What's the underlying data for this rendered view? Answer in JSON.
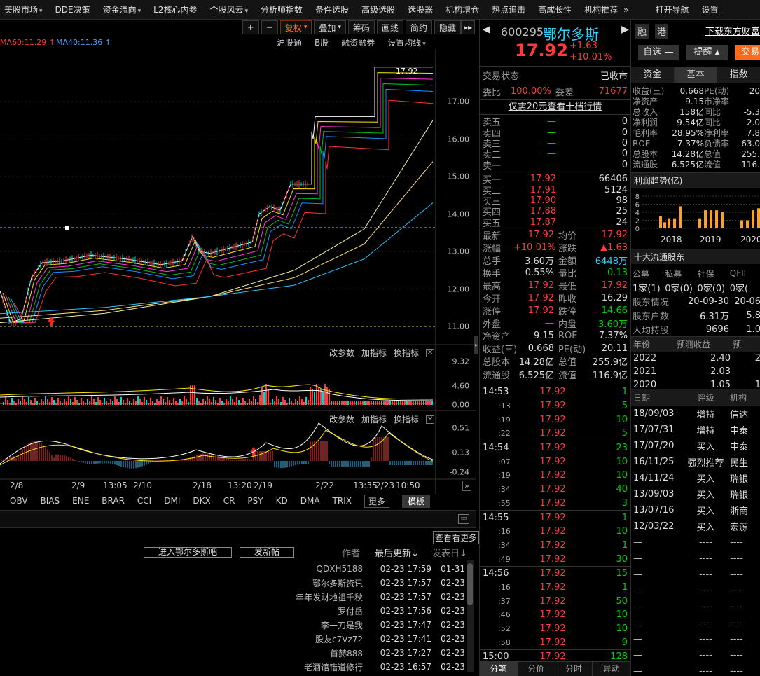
{
  "menu": [
    {
      "t": "美股市场",
      "c": true
    },
    {
      "t": "DDE决策",
      "c": false
    },
    {
      "t": "资金流向",
      "c": true
    },
    {
      "t": "L2核心内参",
      "c": false
    },
    {
      "t": "个股风云",
      "c": true
    },
    {
      "t": "分析师指数",
      "c": false
    },
    {
      "t": "条件选股",
      "c": false
    },
    {
      "t": "高级选股",
      "c": false
    },
    {
      "t": "选股器",
      "c": false
    },
    {
      "t": "机构增仓",
      "c": false
    },
    {
      "t": "热点追击",
      "c": false
    },
    {
      "t": "高成长性",
      "c": false
    },
    {
      "t": "机构推荐",
      "c": false
    },
    {
      "t": "»",
      "c": false
    },
    {
      "t": "打开导航",
      "c": false
    },
    {
      "t": "设置",
      "c": false
    }
  ],
  "toolbar": {
    "plus": "+",
    "minus": "−",
    "fq": "复权",
    "overlay": "叠加",
    "chip": "筹码",
    "draw": "画线",
    "simple": "简约",
    "hide": "隐藏",
    "expand": "▸▸"
  },
  "ma": {
    "ma60_label": "MA60:11.29",
    "ma40_label": "MA40:11.36",
    "links": [
      "沪股通",
      "B股",
      "融资融券",
      "设置均线"
    ]
  },
  "price_axis": [
    "17.00",
    "16.00",
    "15.00",
    "14.00",
    "13.00",
    "12.00",
    "11.00"
  ],
  "price_tag": "17.92",
  "sub1": {
    "buttons": [
      "改参数",
      "加指标",
      "换指标"
    ],
    "axis": [
      "9.32",
      "4.60",
      "0.00"
    ]
  },
  "sub2": {
    "buttons": [
      "改参数",
      "加指标",
      "换指标"
    ],
    "axis": [
      "0.51",
      "0.13",
      "-0.24"
    ]
  },
  "dates": [
    "2/8",
    "2/9",
    "13:05",
    "2/10",
    "2/18",
    "13:20",
    "2/19",
    "2/22",
    "13:35",
    "2/23",
    "10:50"
  ],
  "indicators": [
    "OBV",
    "BIAS",
    "ENE",
    "BRAR",
    "CCI",
    "DMI",
    "DKX",
    "CR",
    "PSY",
    "KD",
    "DMA",
    "TRIX"
  ],
  "ind_more": "更多",
  "ind_tpl": "模板",
  "forum": {
    "more": "查看看更多",
    "enter": "进入鄂尔多斯吧",
    "post": "发新帖",
    "author": "作者",
    "latest": "最后更新↓",
    "published": "发表日↓",
    "rows": [
      {
        "u": "QDXH5188",
        "t": "02-23 17:59",
        "d": "01-31"
      },
      {
        "u": "鄂尔多斯资讯",
        "t": "02-23 17:57",
        "d": "02-23"
      },
      {
        "u": "年年发财地祖千秋",
        "t": "02-23 17:57",
        "d": "02-23"
      },
      {
        "u": "罗付岳",
        "t": "02-23 17:56",
        "d": "02-23"
      },
      {
        "u": "李一刀是我",
        "t": "02-23 17:47",
        "d": "02-23"
      },
      {
        "u": "股友c7Vz72",
        "t": "02-23 17:41",
        "d": "02-23"
      },
      {
        "u": "首赫888",
        "t": "02-23 17:27",
        "d": "02-23"
      },
      {
        "u": "老酒馆错道修行",
        "t": "02-23 16:57",
        "d": "02-23"
      }
    ]
  },
  "stock": {
    "code": "600295",
    "name": "鄂尔多斯",
    "tag1": "融",
    "tag2": "港",
    "download": "下载东方财富",
    "price": "17.92",
    "chg": "+1.63",
    "pct": "+10.01%",
    "btn_watch": "自选 —",
    "btn_alert": "提醒 ▴",
    "btn_trade": "交易"
  },
  "qpanel": {
    "status_label": "交易状态",
    "status_val": "已收市",
    "wb_label": "委比",
    "wb_val": "100.00%",
    "wc_label": "委差",
    "wc_val": "71677",
    "promo": "仅需20元查看十档行情",
    "sells": [
      {
        "l": "卖五",
        "p": "—",
        "v": "0"
      },
      {
        "l": "卖四",
        "p": "—",
        "v": "0"
      },
      {
        "l": "卖三",
        "p": "—",
        "v": "0"
      },
      {
        "l": "卖二",
        "p": "—",
        "v": "0"
      },
      {
        "l": "卖一",
        "p": "—",
        "v": "0"
      }
    ],
    "buys": [
      {
        "l": "买一",
        "p": "17.92",
        "v": "66406"
      },
      {
        "l": "买二",
        "p": "17.91",
        "v": "5124"
      },
      {
        "l": "买三",
        "p": "17.90",
        "v": "98"
      },
      {
        "l": "买四",
        "p": "17.88",
        "v": "25"
      },
      {
        "l": "买五",
        "p": "17.87",
        "v": "24"
      }
    ],
    "stats": [
      [
        "最新",
        "17.92",
        "red",
        "均价",
        "17.92",
        "red"
      ],
      [
        "涨幅",
        "+10.01%",
        "red",
        "涨跌",
        "▲1.63",
        "red"
      ],
      [
        "总手",
        "3.60万",
        "white",
        "金额",
        "6448万",
        "cyan"
      ],
      [
        "换手",
        "0.55%",
        "white",
        "量比",
        "0.13",
        "green"
      ],
      [
        "最高",
        "17.92",
        "red",
        "最低",
        "17.92",
        "red"
      ],
      [
        "今开",
        "17.92",
        "red",
        "昨收",
        "16.29",
        "white"
      ],
      [
        "涨停",
        "17.92",
        "red",
        "跌停",
        "14.66",
        "green"
      ],
      [
        "外盘",
        "—",
        "green",
        "内盘",
        "3.60万",
        "green"
      ],
      [
        "净资产",
        "9.15",
        "white",
        "ROE",
        "7.37%",
        "white"
      ],
      [
        "收益(三)",
        "0.668",
        "white",
        "PE(动)",
        "20.11",
        "white"
      ],
      [
        "总股本",
        "14.28亿",
        "white",
        "总值",
        "255.9亿",
        "white"
      ],
      [
        "流通股",
        "6.525亿",
        "white",
        "流值",
        "116.9亿",
        "white"
      ]
    ],
    "ticks": [
      {
        "t": "14:53",
        "p": "17.92",
        "v": "1",
        "big": true
      },
      {
        "t": ":13",
        "p": "17.92",
        "v": "5"
      },
      {
        "t": ":19",
        "p": "17.92",
        "v": "10"
      },
      {
        "t": ":22",
        "p": "17.92",
        "v": "5"
      },
      {
        "t": "14:54",
        "p": "17.92",
        "v": "23",
        "big": true
      },
      {
        "t": ":07",
        "p": "17.92",
        "v": "10"
      },
      {
        "t": ":19",
        "p": "17.92",
        "v": "10"
      },
      {
        "t": ":34",
        "p": "17.92",
        "v": "40"
      },
      {
        "t": ":55",
        "p": "17.92",
        "v": "3"
      },
      {
        "t": "14:55",
        "p": "17.92",
        "v": "1",
        "big": true
      },
      {
        "t": ":16",
        "p": "17.92",
        "v": "10"
      },
      {
        "t": ":34",
        "p": "17.92",
        "v": "1"
      },
      {
        "t": ":49",
        "p": "17.92",
        "v": "30"
      },
      {
        "t": "14:56",
        "p": "17.92",
        "v": "15",
        "big": true
      },
      {
        "t": ":16",
        "p": "17.92",
        "v": "1"
      },
      {
        "t": ":37",
        "p": "17.92",
        "v": "50"
      },
      {
        "t": ":46",
        "p": "17.92",
        "v": "10"
      },
      {
        "t": ":52",
        "p": "17.92",
        "v": "10"
      },
      {
        "t": ":58",
        "p": "17.92",
        "v": "9"
      },
      {
        "t": "15:00",
        "p": "17.92",
        "v": "128",
        "big": true
      }
    ],
    "bottom_tabs": [
      "分笔",
      "分价",
      "分时",
      "异动"
    ]
  },
  "rpanel": {
    "tabs": [
      "资金",
      "基本",
      "指数"
    ],
    "fin": [
      [
        "收益(三)",
        "0.668",
        "PE(动)",
        "20"
      ],
      [
        "净资产",
        "9.15",
        "市净率",
        ""
      ],
      [
        "总收入",
        "158亿",
        "同比",
        "-5.3"
      ],
      [
        "净利润",
        "9.54亿",
        "同比",
        "-2.0"
      ],
      [
        "毛利率",
        "28.95%",
        "净利率",
        "7.8"
      ],
      [
        "ROE",
        "7.37%",
        "负债率",
        "63.0"
      ],
      [
        "总股本",
        "14.28亿",
        "总值",
        "255."
      ],
      [
        "流通股",
        "6.525亿",
        "流值",
        "116."
      ]
    ],
    "profit_title": "利润趋势(亿)",
    "profit_axis": [
      "8",
      "6",
      "4",
      "2",
      "0"
    ],
    "profit_years": [
      "2018",
      "2019",
      "2020"
    ],
    "holders_title": "十大流通股东",
    "holder_cats": [
      "公募",
      "私募",
      "社保",
      "QFII"
    ],
    "holder_vals": [
      "1家(1)",
      "0家(0)",
      "0家(0)",
      "0家("
    ],
    "holder_rows": [
      [
        "股东情况",
        "20-09-30",
        "20-06"
      ],
      [
        "股东户数",
        "6.31万",
        "5.8"
      ],
      [
        "人均持股",
        "9696",
        "1.0"
      ]
    ],
    "forecast_hdr": [
      "年份",
      "预测收益",
      "预"
    ],
    "forecast": [
      [
        "2022",
        "2.40",
        "2"
      ],
      [
        "2021",
        "2.03",
        ""
      ],
      [
        "2020",
        "1.05",
        "1"
      ]
    ],
    "rating_hdr": [
      "日期",
      "评级",
      "机构"
    ],
    "ratings": [
      [
        "18/09/03",
        "增持",
        "信达"
      ],
      [
        "17/07/31",
        "增持",
        "中泰"
      ],
      [
        "17/07/20",
        "买入",
        "中泰"
      ],
      [
        "16/11/25",
        "强烈推荐",
        "民生"
      ],
      [
        "14/11/24",
        "买入",
        "瑞银"
      ],
      [
        "13/09/03",
        "买入",
        "瑞银"
      ],
      [
        "13/07/16",
        "买入",
        "浙商"
      ],
      [
        "12/03/22",
        "买入",
        "宏源"
      ],
      [
        "—",
        "----",
        "----"
      ],
      [
        "—",
        "----",
        "----"
      ],
      [
        "—",
        "----",
        "----"
      ],
      [
        "—",
        "----",
        "----"
      ],
      [
        "—",
        "----",
        "----"
      ],
      [
        "—",
        "----",
        "----"
      ],
      [
        "—",
        "----",
        "----"
      ],
      [
        "—",
        "----",
        "----"
      ],
      [
        "—",
        "----",
        "----"
      ],
      [
        "—",
        "----",
        "----"
      ]
    ]
  },
  "colors": {
    "up": "#ff3a3a",
    "down": "#00d000",
    "accent": "#ff6a1a"
  }
}
